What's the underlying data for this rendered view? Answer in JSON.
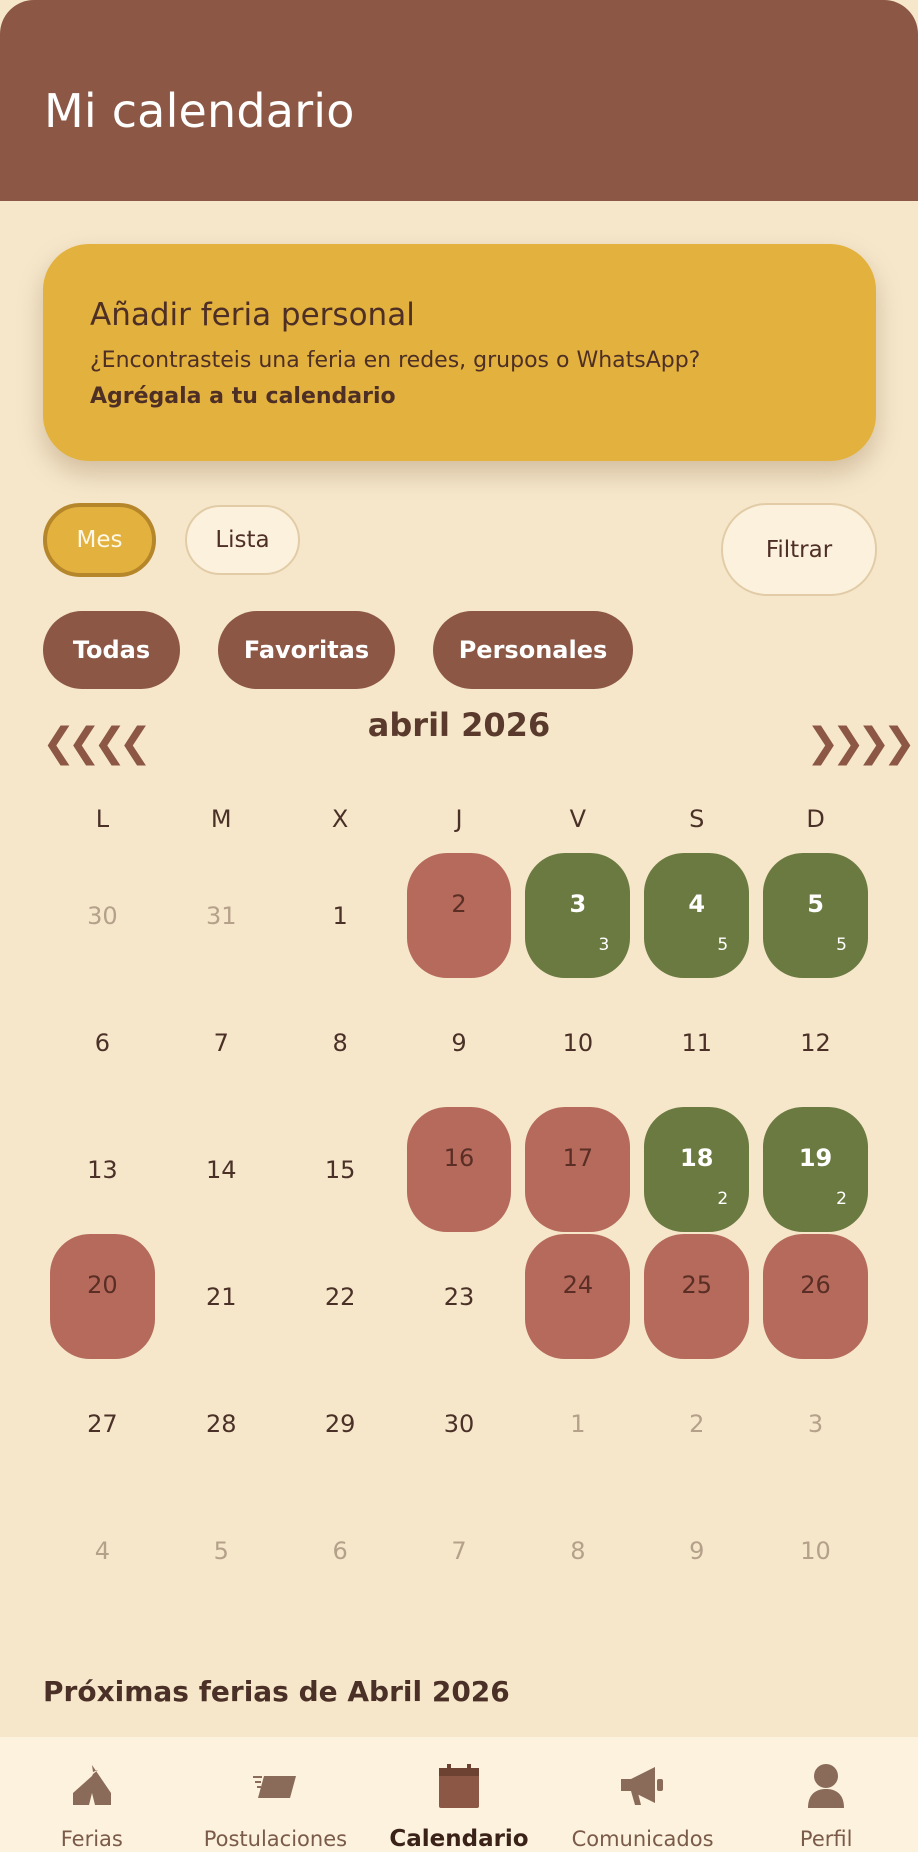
{
  "header": {
    "title": "Mi calendario"
  },
  "promo": {
    "title": "Añadir feria personal",
    "subtitle": "¿Encontrasteis una feria en redes, grupos o WhatsApp?",
    "link": "Agrégala a tu calendario"
  },
  "view_toggle": {
    "month_label": "Mes",
    "list_label": "Lista",
    "selected": "Mes"
  },
  "filter_button": "Filtrar",
  "filter_chips": [
    "Todas",
    "Favoritas",
    "Personales"
  ],
  "calendar": {
    "month_title": "abril 2026",
    "prev_label": "❮❮❮❮",
    "next_label": "❯❯❯❯",
    "weekdays": [
      "L",
      "M",
      "X",
      "J",
      "V",
      "S",
      "D"
    ],
    "colors": {
      "personal": "#b56a5c",
      "fair": "#6b7a40"
    },
    "days": [
      {
        "day": "30",
        "muted": true
      },
      {
        "day": "31",
        "muted": true
      },
      {
        "day": "1"
      },
      {
        "day": "2",
        "event": "personal"
      },
      {
        "day": "3",
        "event": "fair",
        "count": "3"
      },
      {
        "day": "4",
        "event": "fair",
        "count": "5"
      },
      {
        "day": "5",
        "event": "fair",
        "count": "5"
      },
      {
        "day": "6"
      },
      {
        "day": "7"
      },
      {
        "day": "8"
      },
      {
        "day": "9"
      },
      {
        "day": "10"
      },
      {
        "day": "11"
      },
      {
        "day": "12"
      },
      {
        "day": "13"
      },
      {
        "day": "14"
      },
      {
        "day": "15"
      },
      {
        "day": "16",
        "event": "personal"
      },
      {
        "day": "17",
        "event": "personal"
      },
      {
        "day": "18",
        "event": "fair",
        "count": "2"
      },
      {
        "day": "19",
        "event": "fair",
        "count": "2"
      },
      {
        "day": "20",
        "event": "personal"
      },
      {
        "day": "21"
      },
      {
        "day": "22"
      },
      {
        "day": "23"
      },
      {
        "day": "24",
        "event": "personal"
      },
      {
        "day": "25",
        "event": "personal"
      },
      {
        "day": "26",
        "event": "personal"
      },
      {
        "day": "27"
      },
      {
        "day": "28"
      },
      {
        "day": "29"
      },
      {
        "day": "30"
      },
      {
        "day": "1",
        "muted": true
      },
      {
        "day": "2",
        "muted": true
      },
      {
        "day": "3",
        "muted": true
      },
      {
        "day": "4",
        "muted": true
      },
      {
        "day": "5",
        "muted": true
      },
      {
        "day": "6",
        "muted": true
      },
      {
        "day": "7",
        "muted": true
      },
      {
        "day": "8",
        "muted": true
      },
      {
        "day": "9",
        "muted": true
      },
      {
        "day": "10",
        "muted": true
      }
    ]
  },
  "upcoming_title": "Próximas ferias de Abril 2026",
  "bottom_nav": [
    {
      "label": "Ferias",
      "icon": "tent-icon"
    },
    {
      "label": "Postulaciones",
      "icon": "ticket-icon"
    },
    {
      "label": "Calendario",
      "icon": "calendar-icon",
      "active": true
    },
    {
      "label": "Comunicados",
      "icon": "megaphone-icon"
    },
    {
      "label": "Perfil",
      "icon": "person-icon"
    }
  ]
}
